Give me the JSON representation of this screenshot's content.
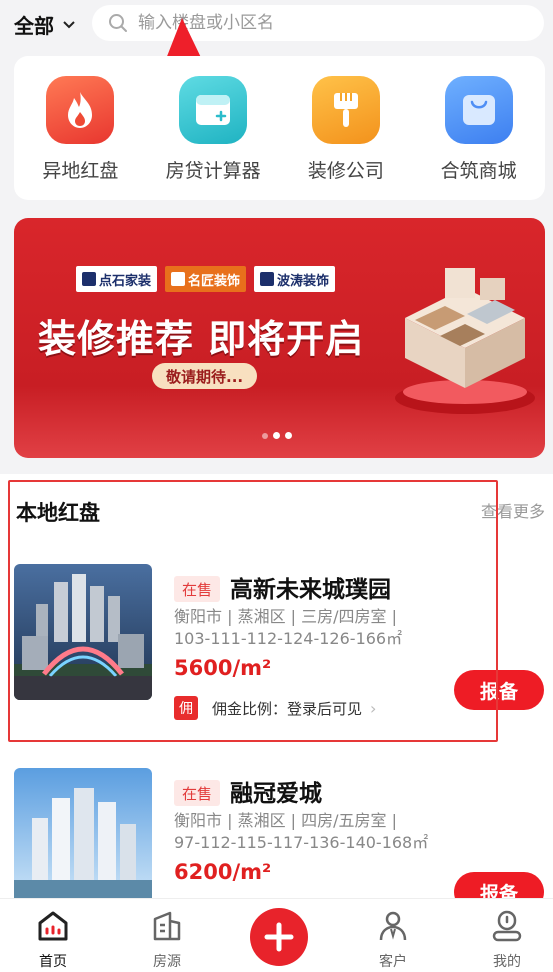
{
  "header": {
    "city": "全部",
    "search_placeholder": "输入楼盘或小区名"
  },
  "quick_menu": [
    {
      "label": "异地红盘",
      "icon": "flame-icon",
      "color": "#f0553f"
    },
    {
      "label": "房贷计算器",
      "icon": "calculator-icon",
      "color": "#3ac4cf"
    },
    {
      "label": "装修公司",
      "icon": "paint-brush-icon",
      "color": "#f7a92a"
    },
    {
      "label": "合筑商城",
      "icon": "shopping-bag-icon",
      "color": "#4e8ef5"
    }
  ],
  "banner": {
    "logos": [
      "点石家装",
      "名匠装饰",
      "波涛装饰"
    ],
    "title": "装修推荐 即将开启",
    "pill": "敬请期待..."
  },
  "section": {
    "title": "本地红盘",
    "more": "查看更多"
  },
  "listings": [
    {
      "status": "在售",
      "name": "高新未来城璞园",
      "meta_line1": "衡阳市 | 蒸湘区 | 三房/四房室 |",
      "meta_line2": "103-111-112-124-126-166㎡",
      "price": "5600/m²",
      "commission_badge": "佣",
      "commission_text": "佣金比例：登录后可见",
      "report_label": "报备"
    },
    {
      "status": "在售",
      "name": "融冠爱城",
      "meta_line1": "衡阳市 | 蒸湘区 | 四房/五房室 |",
      "meta_line2": "97-112-115-117-136-140-168㎡",
      "price": "6200/m²",
      "report_label": "报备"
    }
  ],
  "tabbar": [
    {
      "label": "首页",
      "icon": "home-icon",
      "active": true
    },
    {
      "label": "房源",
      "icon": "building-icon"
    },
    {
      "label": "",
      "icon": "plus-icon"
    },
    {
      "label": "客户",
      "icon": "customer-icon"
    },
    {
      "label": "我的",
      "icon": "profile-icon"
    }
  ],
  "colors": {
    "accent": "#ee1c25",
    "annotation": "#e63838"
  }
}
